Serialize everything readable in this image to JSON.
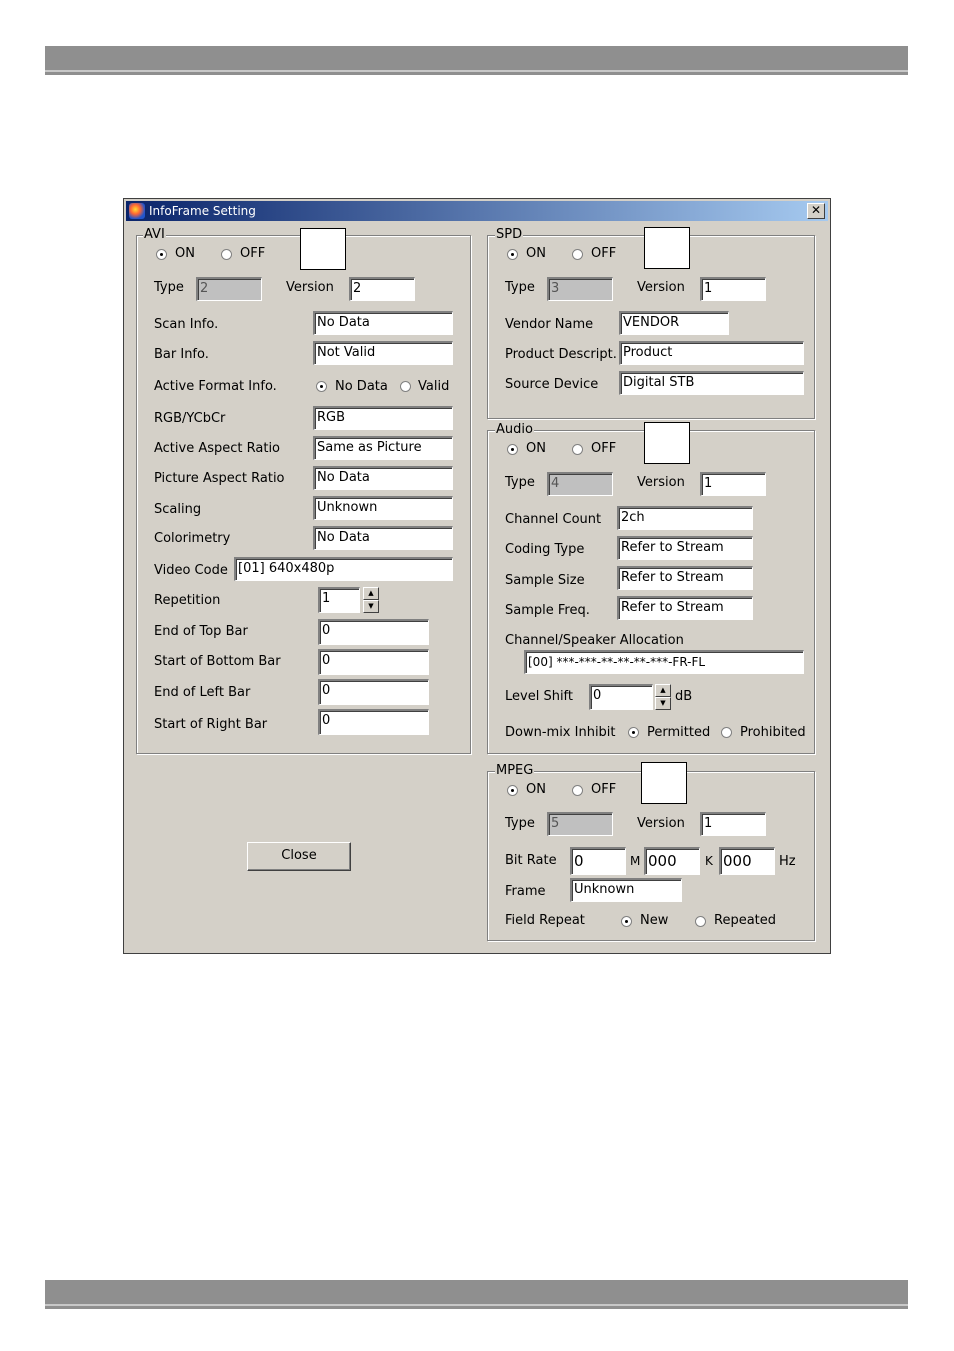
{
  "window": {
    "title": "InfoFrame Setting",
    "close_glyph": "✕"
  },
  "avi": {
    "legend": "AVI",
    "on_label": "ON",
    "off_label": "OFF",
    "selected": "ON",
    "type_label": "Type",
    "type_value": "2",
    "version_label": "Version",
    "version_value": "2",
    "scan_info_label": "Scan Info.",
    "scan_info_value": "No Data",
    "bar_info_label": "Bar Info.",
    "bar_info_value": "Not Valid",
    "active_format_label": "Active Format Info.",
    "active_format_no_data": "No Data",
    "active_format_valid": "Valid",
    "rgb_label": "RGB/YCbCr",
    "rgb_value": "RGB",
    "active_aspect_label": "Active Aspect Ratio",
    "active_aspect_value": "Same as Picture",
    "picture_aspect_label": "Picture Aspect Ratio",
    "picture_aspect_value": "No Data",
    "scaling_label": "Scaling",
    "scaling_value": "Unknown",
    "colorimetry_label": "Colorimetry",
    "colorimetry_value": "No Data",
    "video_code_label": "Video Code",
    "video_code_value": "[01] 640x480p",
    "repetition_label": "Repetition",
    "repetition_value": "1",
    "end_top_bar_label": "End of Top Bar",
    "end_top_bar_value": "0",
    "start_bottom_bar_label": "Start of Bottom Bar",
    "start_bottom_bar_value": "0",
    "end_left_bar_label": "End of Left Bar",
    "end_left_bar_value": "0",
    "start_right_bar_label": "Start of Right Bar",
    "start_right_bar_value": "0"
  },
  "spd": {
    "legend": "SPD",
    "on_label": "ON",
    "off_label": "OFF",
    "type_label": "Type",
    "type_value": "3",
    "version_label": "Version",
    "version_value": "1",
    "vendor_label": "Vendor Name",
    "vendor_value": "VENDOR",
    "product_label": "Product Descript.",
    "product_value": "Product",
    "source_label": "Source Device",
    "source_value": "Digital STB"
  },
  "audio": {
    "legend": "Audio",
    "on_label": "ON",
    "off_label": "OFF",
    "type_label": "Type",
    "type_value": "4",
    "version_label": "Version",
    "version_value": "1",
    "channel_count_label": "Channel Count",
    "channel_count_value": "2ch",
    "coding_type_label": "Coding Type",
    "coding_type_value": "Refer to Stream",
    "sample_size_label": "Sample Size",
    "sample_size_value": "Refer to Stream",
    "sample_freq_label": "Sample Freq.",
    "sample_freq_value": "Refer to Stream",
    "allocation_label": "Channel/Speaker Allocation",
    "allocation_value": "[00] ***-***-**-**-**-***-FR-FL",
    "level_shift_label": "Level Shift",
    "level_shift_value": "0",
    "level_shift_unit": "dB",
    "downmix_label": "Down-mix Inhibit",
    "downmix_permitted": "Permitted",
    "downmix_prohibited": "Prohibited"
  },
  "mpeg": {
    "legend": "MPEG",
    "on_label": "ON",
    "off_label": "OFF",
    "type_label": "Type",
    "type_value": "5",
    "version_label": "Version",
    "version_value": "1",
    "bitrate_label": "Bit Rate",
    "bitrate_value": "0",
    "m_label": "M",
    "m_value": "000",
    "k_label": "K",
    "k_value": "000",
    "hz_label": "Hz",
    "frame_label": "Frame",
    "frame_value": "Unknown",
    "field_repeat_label": "Field Repeat",
    "field_new": "New",
    "field_repeated": "Repeated"
  },
  "close_button_label": "Close"
}
